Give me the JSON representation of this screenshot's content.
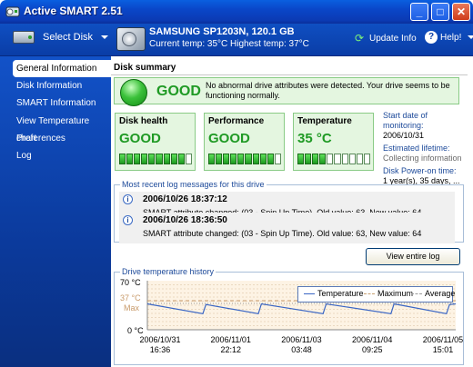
{
  "window": {
    "title": "Active SMART 2.51",
    "minimize": "_",
    "maximize": "□",
    "close": "✕"
  },
  "header": {
    "select_disk": "Select Disk",
    "drive_name": "SAMSUNG SP1203N, 120.1 GB",
    "drive_temp": "Current temp: 35°C  Highest temp: 37°C",
    "update_info": "Update Info",
    "help": "Help!"
  },
  "sidebar": {
    "items": [
      {
        "label": "General Information",
        "active": true
      },
      {
        "label": "Disk Information"
      },
      {
        "label": "SMART Information"
      },
      {
        "label": "View Temperature chart"
      },
      {
        "label": "Preferences"
      },
      {
        "label": "Log"
      }
    ]
  },
  "main": {
    "title": "Disk summary",
    "status": {
      "word": "GOOD",
      "message": "No abnormal drive attributes were detected. Your drive seems to be functioning normally."
    },
    "cards": [
      {
        "title": "Disk health",
        "value": "GOOD",
        "level": 9,
        "of": 10
      },
      {
        "title": "Performance",
        "value": "GOOD",
        "level": 9,
        "of": 10
      },
      {
        "title": "Temperature",
        "value": "35 °C",
        "level": 4,
        "of": 10
      }
    ],
    "info": {
      "start_label": "Start date of monitoring:",
      "start_value": "2006/10/31",
      "lifetime_label": "Estimated lifetime:",
      "lifetime_value": "Collecting information",
      "power_label": "Disk Power-on time:",
      "power_value": "1 year(s), 35 days, ..."
    },
    "log": {
      "title": "Most recent log messages for this drive",
      "entries": [
        {
          "date": "2006/10/26 18:37:12",
          "message": "SMART attribute changed: (03 - Spin Up Time). Old value: 63, New value: 64"
        },
        {
          "date": "2006/10/26 18:36:50",
          "message": "SMART attribute changed: (03 - Spin Up Time). Old value: 63, New value: 64"
        }
      ],
      "view_button": "View entire log"
    },
    "temp_history": {
      "title": "Drive temperature history",
      "y_top": "70 °C",
      "y_avg": "37 °C",
      "y_max": "Max",
      "y_bottom": "0 °C",
      "x_ticks": [
        {
          "date": "2006/10/31",
          "time": "16:36"
        },
        {
          "date": "2006/11/01",
          "time": "22:12"
        },
        {
          "date": "2006/11/03",
          "time": "03:48"
        },
        {
          "date": "2006/11/04",
          "time": "09:25"
        },
        {
          "date": "2006/11/05",
          "time": "15:01"
        }
      ],
      "legend": {
        "temperature": "Temperature",
        "maximum": "Maximum",
        "average": "Average"
      },
      "colors": {
        "temperature": "#3a66c4",
        "maximum": "#c89a6a",
        "average": "#9a9a9a"
      }
    }
  },
  "chart_data": {
    "type": "line",
    "title": "Drive temperature history",
    "xlabel": "",
    "ylabel": "",
    "x_ticks": [
      "2006/10/31 16:36",
      "2006/11/01 22:12",
      "2006/11/03 03:48",
      "2006/11/04 09:25",
      "2006/11/05 15:01"
    ],
    "ylim": [
      0,
      70
    ],
    "y_ticks": [
      0,
      37,
      70
    ],
    "series": [
      {
        "name": "Temperature",
        "x": [
          0,
          0.18,
          0.19,
          0.36,
          0.37,
          0.57,
          0.58,
          0.79,
          0.8,
          0.97,
          0.98,
          1.0
        ],
        "values": [
          37,
          23,
          36,
          23,
          37,
          23,
          37,
          23,
          37,
          23,
          36,
          37
        ]
      },
      {
        "name": "Maximum",
        "values": [
          37
        ]
      },
      {
        "name": "Average",
        "values": [
          30
        ]
      }
    ],
    "legend": "top-right",
    "grid": true
  }
}
